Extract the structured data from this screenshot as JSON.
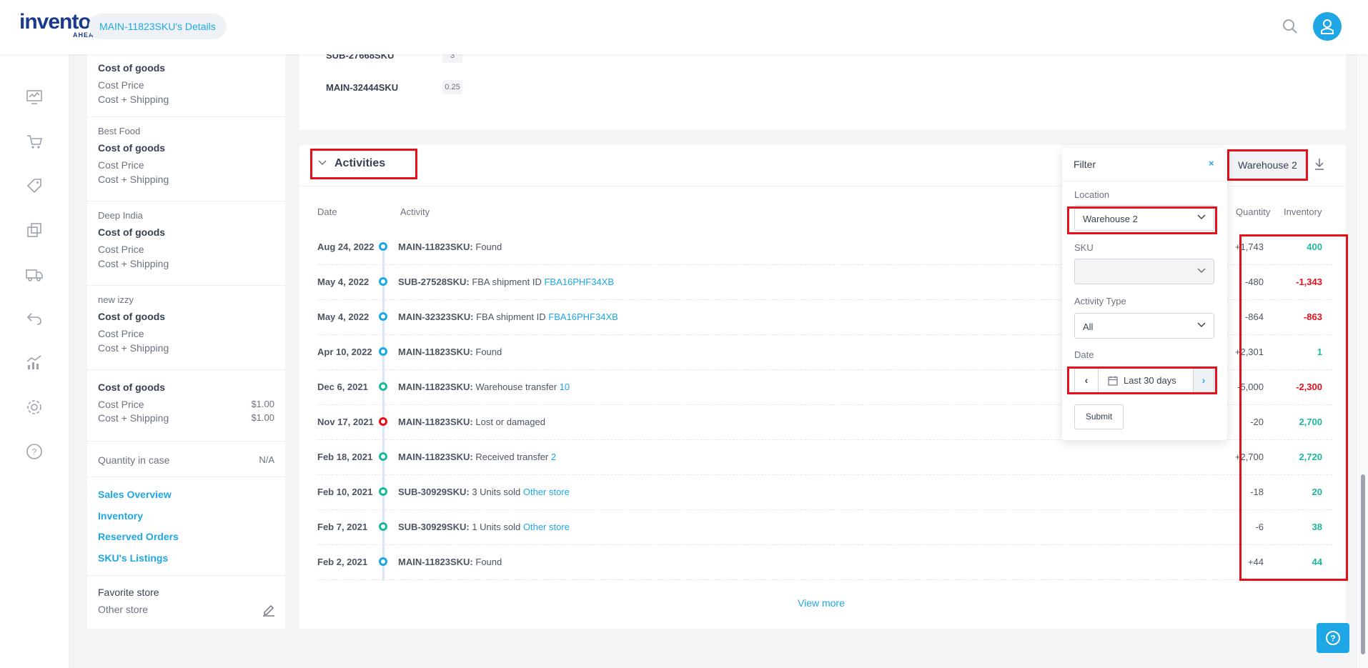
{
  "header": {
    "logo": "inventory",
    "logo_sub": "AHEAD",
    "breadcrumb": "MAIN-11823SKU's Details"
  },
  "nav": {
    "icons": [
      "dashboard-icon",
      "cart-icon",
      "tag-icon",
      "copy-icon",
      "truck-icon",
      "return-icon",
      "analytics-icon",
      "settings-icon",
      "help-circle-icon"
    ]
  },
  "side_panel": {
    "block0": {
      "title": "Cost of goods",
      "line1": "Cost Price",
      "line2": "Cost + Shipping"
    },
    "block1": {
      "store": "Best Food",
      "title": "Cost of goods",
      "line1": "Cost Price",
      "line2": "Cost + Shipping"
    },
    "block2": {
      "store": "Deep India",
      "title": "Cost of goods",
      "line1": "Cost Price",
      "line2": "Cost + Shipping"
    },
    "block3": {
      "store": "new izzy",
      "title": "Cost of goods",
      "line1": "Cost Price",
      "line2": "Cost + Shipping"
    },
    "block4": {
      "title": "Cost of goods",
      "line1": "Cost Price",
      "line1_val": "$1.00",
      "line2": "Cost + Shipping",
      "line2_val": "$1.00"
    },
    "qty_case": {
      "label": "Quantity in case",
      "value": "N/A"
    },
    "links": [
      "Sales Overview",
      "Inventory",
      "Reserved Orders",
      "SKU's Listings"
    ],
    "favorite": {
      "label": "Favorite store",
      "value": "Other store"
    }
  },
  "top_card": {
    "rows": [
      {
        "sku": "SUB-27668SKU",
        "qty": "3"
      },
      {
        "sku": "MAIN-32444SKU",
        "qty": "0.25"
      }
    ]
  },
  "activities": {
    "title": "Activities",
    "location_button": "Warehouse 2",
    "columns": {
      "date": "Date",
      "activity": "Activity",
      "quantity": "Quantity",
      "inventory": "Inventory"
    },
    "rows": [
      {
        "date": "Aug 24, 2022",
        "sku": "MAIN-11823SKU:",
        "text": " Found",
        "link": "",
        "qty": "+1,743",
        "inv": "400",
        "inv_color": "#1fb79c",
        "dot": "#1ea7e4"
      },
      {
        "date": "May 4, 2022",
        "sku": "SUB-27528SKU:",
        "text": " FBA shipment ID ",
        "link": "FBA16PHF34XB",
        "qty": "-480",
        "inv": "-1,343",
        "inv_color": "#e5101c",
        "dot": "#1ea7e4"
      },
      {
        "date": "May 4, 2022",
        "sku": "MAIN-32323SKU:",
        "text": " FBA shipment ID ",
        "link": "FBA16PHF34XB",
        "qty": "-864",
        "inv": "-863",
        "inv_color": "#e5101c",
        "dot": "#1ea7e4"
      },
      {
        "date": "Apr 10, 2022",
        "sku": "MAIN-11823SKU:",
        "text": " Found",
        "link": "",
        "qty": "+2,301",
        "inv": "1",
        "inv_color": "#1fb79c",
        "dot": "#1ea7e4"
      },
      {
        "date": "Dec 6, 2021",
        "sku": "MAIN-11823SKU:",
        "text": " Warehouse transfer ",
        "link": "10",
        "qty": "-5,000",
        "inv": "-2,300",
        "inv_color": "#e5101c",
        "dot": "#1fb79c"
      },
      {
        "date": "Nov 17, 2021",
        "sku": "MAIN-11823SKU:",
        "text": " Lost or damaged",
        "link": "",
        "qty": "-20",
        "inv": "2,700",
        "inv_color": "#1fb79c",
        "dot": "#e5101c"
      },
      {
        "date": "Feb 18, 2021",
        "sku": "MAIN-11823SKU:",
        "text": " Received transfer ",
        "link": "2",
        "qty": "+2,700",
        "inv": "2,720",
        "inv_color": "#1fb79c",
        "dot": "#1fb79c"
      },
      {
        "date": "Feb 10, 2021",
        "sku": "SUB-30929SKU:",
        "text": " 3 Units sold ",
        "link": "Other store",
        "qty": "-18",
        "inv": "20",
        "inv_color": "#1fb79c",
        "dot": "#1fb79c"
      },
      {
        "date": "Feb 7, 2021",
        "sku": "SUB-30929SKU:",
        "text": " 1 Units sold ",
        "link": "Other store",
        "qty": "-6",
        "inv": "38",
        "inv_color": "#1fb79c",
        "dot": "#1fb79c"
      },
      {
        "date": "Feb 2, 2021",
        "sku": "MAIN-11823SKU:",
        "text": " Found",
        "link": "",
        "qty": "+44",
        "inv": "44",
        "inv_color": "#1fb79c",
        "dot": "#1ea7e4"
      }
    ],
    "view_more": "View more"
  },
  "filter": {
    "title": "Filter",
    "close": "×",
    "location_label": "Location",
    "location_value": "Warehouse 2",
    "sku_label": "SKU",
    "sku_value": "",
    "activity_type_label": "Activity Type",
    "activity_type_value": "All",
    "date_label": "Date",
    "date_value": "Last 30 days",
    "prev": "‹",
    "next": "›",
    "submit": "Submit"
  },
  "colors": {
    "accent": "#1ea7e4",
    "positive": "#1fb79c",
    "negative": "#e5101c",
    "highlight_box": "#e5101c"
  }
}
